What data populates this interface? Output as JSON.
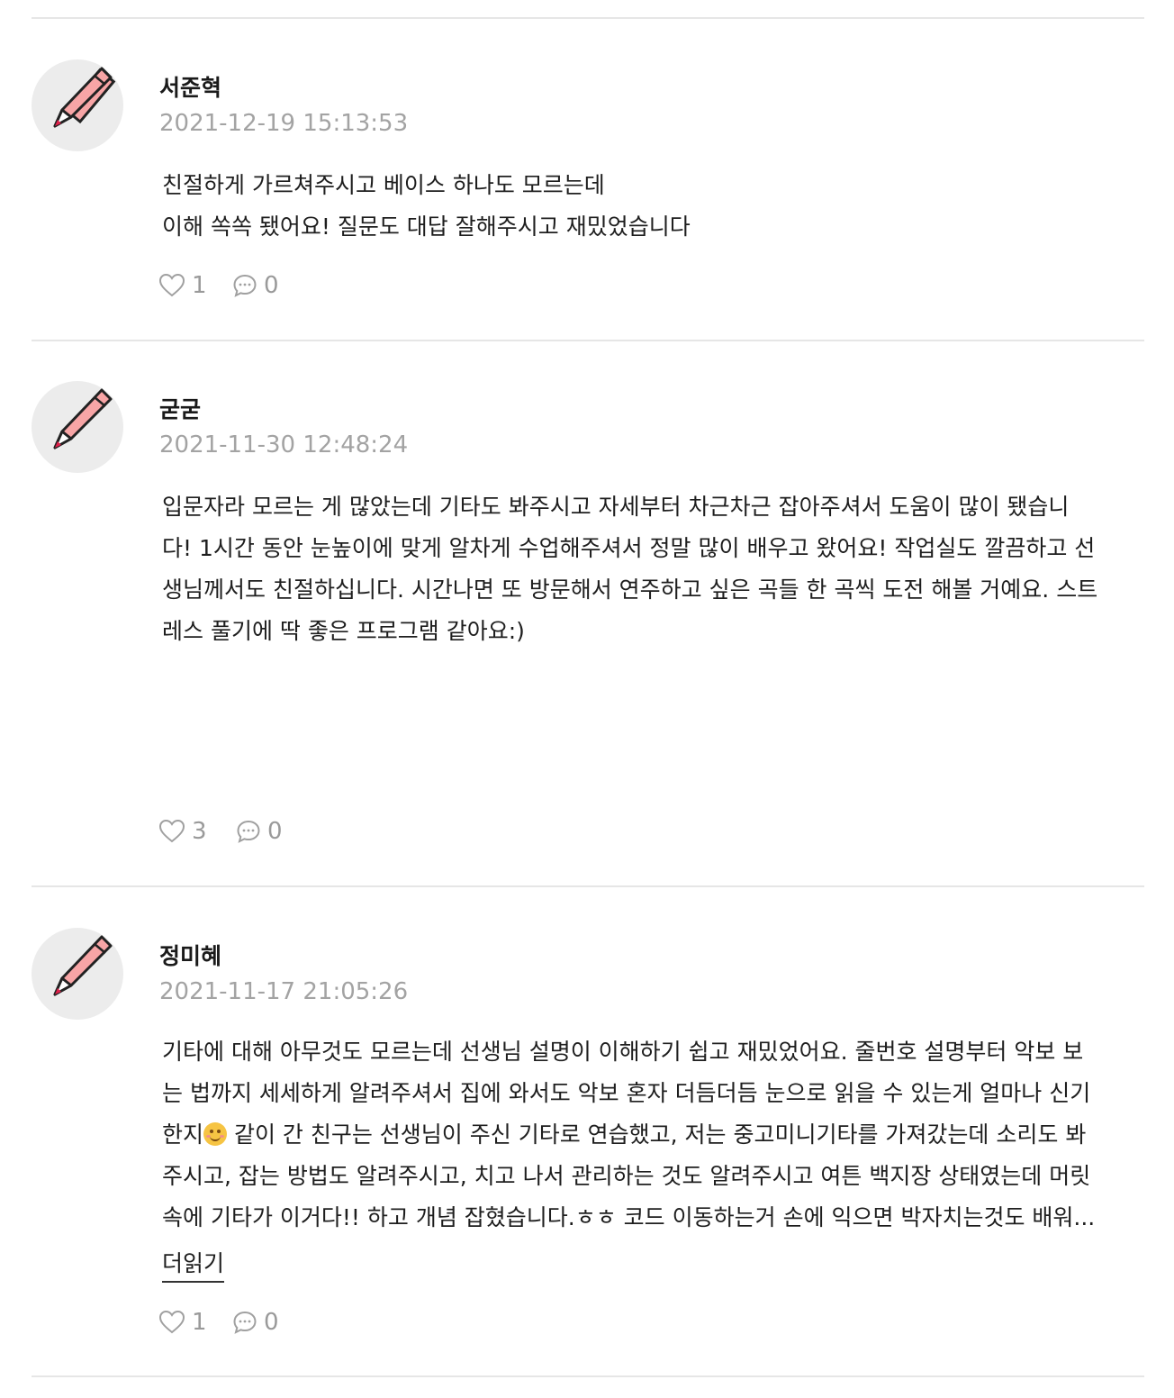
{
  "reviews": [
    {
      "author": "서준혁",
      "date": "2021-12-19 15:13:53",
      "lines": [
        "친절하게 가르쳐주시고 베이스 하나도 모르는데",
        "이해 쏙쏙 됐어요! 질문도 대답 잘해주시고 재밌었습니다"
      ],
      "likes": "1",
      "comments": "0"
    },
    {
      "author": "굳굳",
      "date": "2021-11-30 12:48:24",
      "lines": [
        "입문자라 모르는 게 많았는데 기타도 봐주시고 자세부터 차근차근 잡아주셔서 도움이 많이 됐습니",
        "다! 1시간 동안 눈높이에 맞게 알차게 수업해주셔서 정말 많이 배우고 왔어요! 작업실도 깔끔하고 선",
        "생님께서도 친절하십니다. 시간나면 또 방문해서 연주하고 싶은 곡들 한 곡씩 도전 해볼 거예요. 스트",
        "레스 풀기에 딱 좋은 프로그램 같아요:)"
      ],
      "likes": "3",
      "comments": "0"
    },
    {
      "author": "정미혜",
      "date": "2021-11-17 21:05:26",
      "lines": [
        "기타에 대해 아무것도 모르는데 선생님 설명이 이해하기 쉽고 재밌었어요. 줄번호 설명부터 악보 보",
        "는 법까지 세세하게 알려주셔서 집에 와서도 악보 혼자 더듬더듬 눈으로 읽을 수 있는게 얼마나 신기",
        "한지",
        " 같이 간 친구는 선생님이 주신 기타로 연습했고, 저는 중고미니기타를 가져갔는데 소리도 봐",
        "주시고, 잡는 방법도 알려주시고, 치고 나서 관리하는 것도 알려주시고 여튼 백지장 상태였는데 머릿",
        "속에 기타가 이거다!! 하고 개념 잡혔습니다.ㅎㅎ 코드 이동하는거 손에 익으면 박자치는것도 배워..."
      ],
      "emoji_name": "smiling-face-emoji",
      "more_label": "더읽기",
      "likes": "1",
      "comments": "0"
    }
  ],
  "icons": {
    "avatar": "pencil-icon",
    "like": "heart-icon",
    "comment": "speech-bubble-icon"
  },
  "colors": {
    "pencil_body": "#f8a5a6",
    "pencil_tip": "#e0204b",
    "avatar_bg": "#ececec",
    "meta_gray": "#a3a3a3"
  }
}
